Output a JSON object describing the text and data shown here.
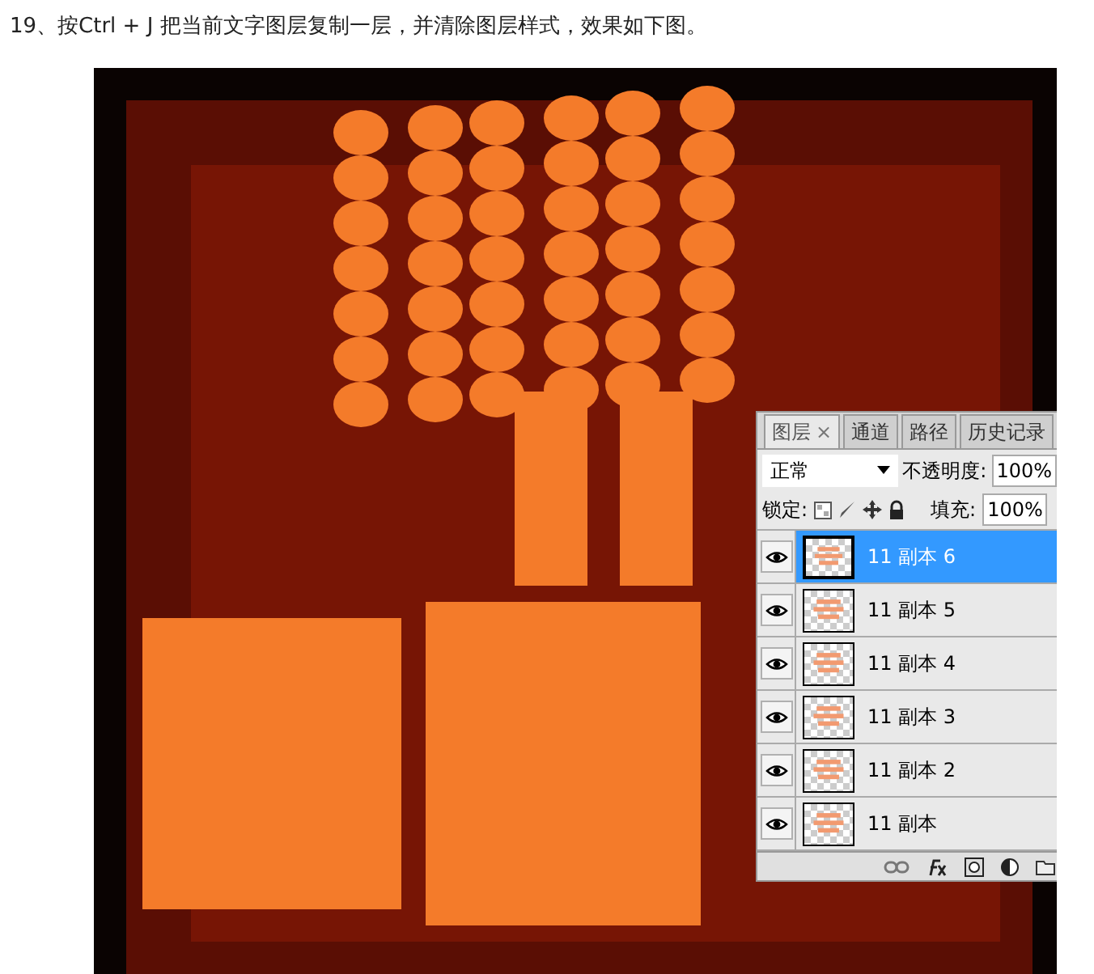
{
  "caption": "19、按Ctrl + J 把当前文字图层复制一层，并清除图层样式，效果如下图。",
  "layers_panel": {
    "tabs": [
      {
        "label": "图层",
        "selected": true,
        "close": "×"
      },
      {
        "label": "通道",
        "selected": false
      },
      {
        "label": "路径",
        "selected": false
      },
      {
        "label": "历史记录",
        "selected": false
      }
    ],
    "blend_mode": "正常",
    "opacity_label": "不透明度:",
    "opacity": "100%",
    "lock_label": "锁定:",
    "fill_label": "填充:",
    "fill": "100%",
    "layers": [
      {
        "name": "11 副本 6",
        "visible": true,
        "selected": true
      },
      {
        "name": "11 副本 5",
        "visible": true,
        "selected": false
      },
      {
        "name": "11 副本 4",
        "visible": true,
        "selected": false
      },
      {
        "name": "11 副本 3",
        "visible": true,
        "selected": false
      },
      {
        "name": "11 副本 2",
        "visible": true,
        "selected": false
      },
      {
        "name": "11 副本",
        "visible": true,
        "selected": false
      }
    ]
  }
}
